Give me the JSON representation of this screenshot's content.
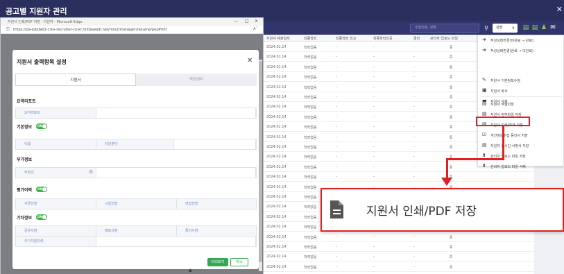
{
  "app": {
    "title": "공고별 지원자 관리",
    "close_glyph": "✕"
  },
  "toolbar": {
    "search_placeholder": "수험번호, 성명",
    "select_value": "성명",
    "accent_color": "#8fd44a"
  },
  "browser": {
    "window_title": "지원서 인쇄/PDF 저장 - 지원자 - Microsoft Edge",
    "url": "https://qa-jobda02-cms-recruiter-co-kr.midasweb.net/mrs2/manager/resume/popPrint",
    "zoom_label": "Aˆ"
  },
  "modal": {
    "title": "지원서 출력항목 설정",
    "tabs": [
      {
        "label": "지원서"
      },
      {
        "label": "역검센터"
      }
    ],
    "sections": {
      "summary": {
        "title": "요약리포트",
        "fields": [
          "요약리포트"
        ]
      },
      "basic": {
        "title": "기본정보",
        "toggle": "ON",
        "fields": [
          "이름",
          "지원분야"
        ]
      },
      "extra": {
        "title": "부가정보",
        "fields": [
          "주변인"
        ]
      },
      "evaluation": {
        "title": "평가이력",
        "toggle": "ON",
        "fields": [
          "서류전형",
          "시험전형",
          "면접전형"
        ]
      },
      "other": {
        "title": "기타정보",
        "toggle": "ON",
        "fields": [
          "공유사항",
          "메모사항",
          "특이사항",
          "추가지원이력"
        ]
      }
    },
    "buttons": {
      "confirm": "미리보기",
      "cancel": "취소"
    }
  },
  "grid": {
    "columns": [
      "지원서 제출일자",
      "최종학력",
      "최종학력 학교",
      "최종학력전공",
      "경력",
      "관리자 업로드 파일"
    ],
    "row_date": "2024.02.14",
    "row_edu": "학력없음",
    "row_empty": "-",
    "row_count": 23
  },
  "menu": {
    "items": [
      {
        "icon": "➜",
        "icon_name": "arrow-right-icon",
        "label": "작성상태변경(미완료 → 완료)"
      },
      {
        "icon": "➜",
        "icon_name": "arrow-left-icon",
        "label": "작성상태변경(완료 → 미완료)"
      },
      {
        "icon": "✎",
        "icon_name": "pencil-icon",
        "label": "지원서 기본정보수정"
      },
      {
        "icon": "▣",
        "icon_name": "copy-icon",
        "label": "지원서 복사"
      },
      {
        "icon": "▬",
        "icon_name": "delete-icon",
        "label": "지원서 삭제"
      },
      {
        "icon": "▤",
        "icon_name": "excel-icon",
        "label": "지원서 엑셀저장"
      },
      {
        "icon": "▤",
        "icon_name": "attachment-icon",
        "label": "지원서 첨부파일 저장"
      },
      {
        "icon": "▤",
        "icon_name": "document-icon",
        "label": "지원서 인쇄/PDF 저장"
      },
      {
        "icon": "☑",
        "icon_name": "consent-icon",
        "label": "개인정보수집 동의서 저장"
      },
      {
        "icon": "▤",
        "icon_name": "signature-icon",
        "label": "지원자 실시간 서명서 저장"
      },
      {
        "icon": "⬆",
        "icon_name": "upload-icon",
        "label": "관리자 업로드 파일 저장"
      },
      {
        "icon": "⬆",
        "icon_name": "upload-delete-icon",
        "label": "관리자 업로드 파일 삭제"
      }
    ],
    "highlight_color": "#e02020"
  },
  "zoom": {
    "label": "지원서 인쇄/PDF 저장"
  }
}
